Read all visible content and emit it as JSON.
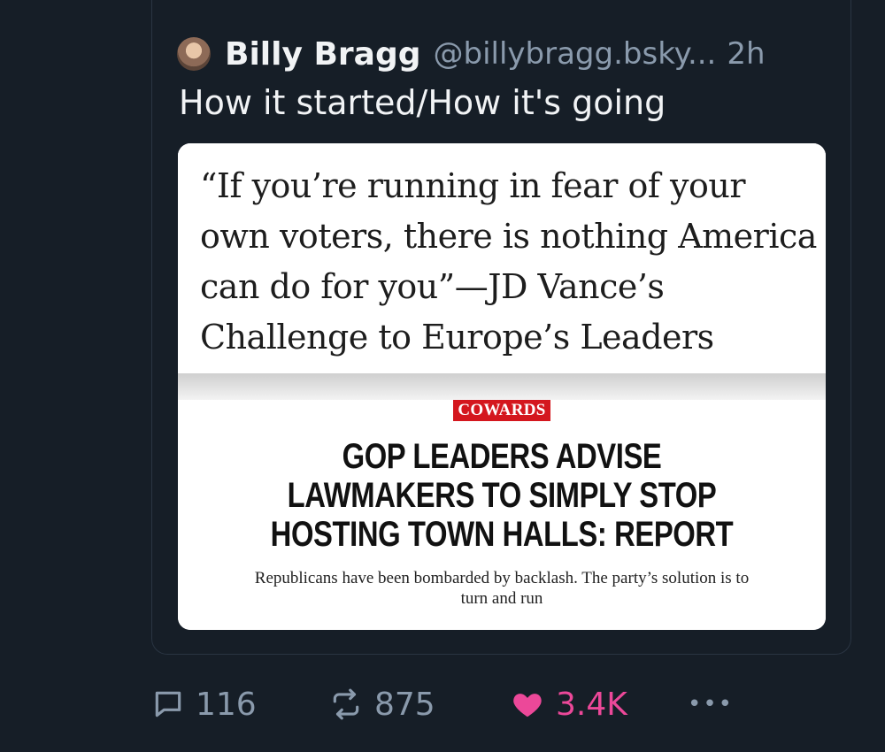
{
  "post": {
    "author_name": "Billy Bragg",
    "author_handle": "@billybragg.bsky...",
    "timestamp": "2h",
    "text": "How it started/How it's going"
  },
  "media": {
    "quote_text": "“If you’re running in fear of your own voters, there is nothing America can do for you”—JD Vance’s Challenge to Europe’s Leaders",
    "tag": "COWARDS",
    "headline": "GOP LEADERS ADVISE LAWMAKERS TO SIMPLY STOP HOSTING TOWN HALLS: REPORT",
    "subhead": "Republicans have been bombarded by backlash. The party’s solution is to turn and run"
  },
  "actions": {
    "replies": "116",
    "reposts": "875",
    "likes": "3.4K",
    "more": "•••"
  },
  "colors": {
    "background": "#161e27",
    "like_active": "#ec4899",
    "tag_red": "#d4171e"
  }
}
